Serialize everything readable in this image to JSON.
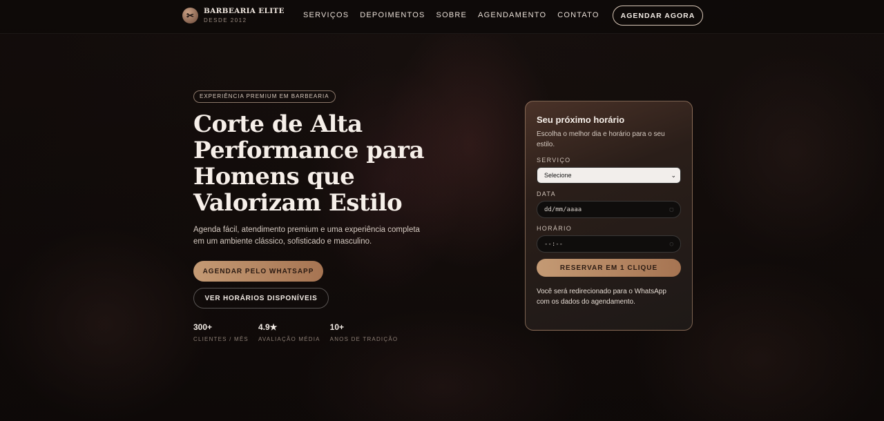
{
  "header": {
    "brand_name": "BARBEARIA ELITE",
    "brand_sub": "DESDE 2012",
    "logo_icon": "scissors-icon",
    "nav": [
      {
        "label": "SERVIÇOS"
      },
      {
        "label": "DEPOIMENTOS"
      },
      {
        "label": "SOBRE"
      },
      {
        "label": "AGENDAMENTO"
      },
      {
        "label": "CONTATO"
      }
    ],
    "cta_label": "AGENDAR AGORA"
  },
  "hero": {
    "eyebrow": "EXPERIÊNCIA PREMIUM EM BARBEARIA",
    "title": "Corte de Alta Performance para Homens que Valorizam Estilo",
    "description": "Agenda fácil, atendimento premium e uma experiência completa em um ambiente clássico, sofisticado e masculino.",
    "primary_button": "AGENDAR PELO WHATSAPP",
    "secondary_button": "VER HORÁRIOS DISPONÍVEIS",
    "stats": [
      {
        "value": "300+",
        "label": "CLIENTES / MÊS"
      },
      {
        "value": "4.9★",
        "label": "AVALIAÇÃO MÉDIA"
      },
      {
        "value": "10+",
        "label": "ANOS DE TRADIÇÃO"
      }
    ]
  },
  "booking": {
    "title": "Seu próximo horário",
    "subtitle": "Escolha o melhor dia e horário para o seu estilo.",
    "service_label": "SERVIÇO",
    "service_value": "Selecione",
    "date_label": "DATA",
    "date_placeholder": "dd/mm/aaaa",
    "time_label": "HORÁRIO",
    "time_placeholder": "--:--",
    "submit_label": "RESERVAR EM 1 CLIQUE",
    "note": "Você será redirecionado para o WhatsApp com os dados do agendamento."
  },
  "colors": {
    "accent": "#c49a74",
    "accent_dark": "#a67452",
    "background": "#120c0a"
  }
}
